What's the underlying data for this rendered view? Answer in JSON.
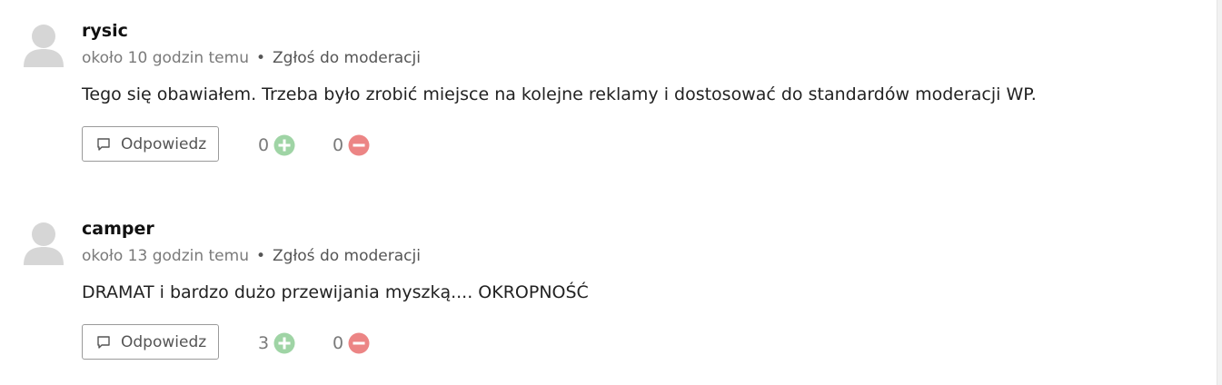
{
  "colors": {
    "upvote": "#9fd4a5",
    "downvote": "#ec8585",
    "avatar": "#d6d6d6",
    "meta_text": "#7a7a7a"
  },
  "icons": {
    "avatar": "user-silhouette-icon",
    "reply": "speech-bubble-icon",
    "upvote": "plus-circle-icon",
    "downvote": "minus-circle-icon"
  },
  "comments": [
    {
      "author": "rysic",
      "time": "około 10 godzin temu",
      "separator": "•",
      "report_label": "Zgłoś do moderacji",
      "text": "Tego się obawiałem. Trzeba było zrobić miejsce na kolejne reklamy i dostosować do standardów moderacji WP.",
      "reply_label": "Odpowiedz",
      "upvotes": "0",
      "downvotes": "0"
    },
    {
      "author": "camper",
      "time": "około 13 godzin temu",
      "separator": "•",
      "report_label": "Zgłoś do moderacji",
      "text": "DRAMAT i bardzo dużo przewijania myszką.... OKROPNOŚĆ",
      "reply_label": "Odpowiedz",
      "upvotes": "3",
      "downvotes": "0"
    }
  ]
}
